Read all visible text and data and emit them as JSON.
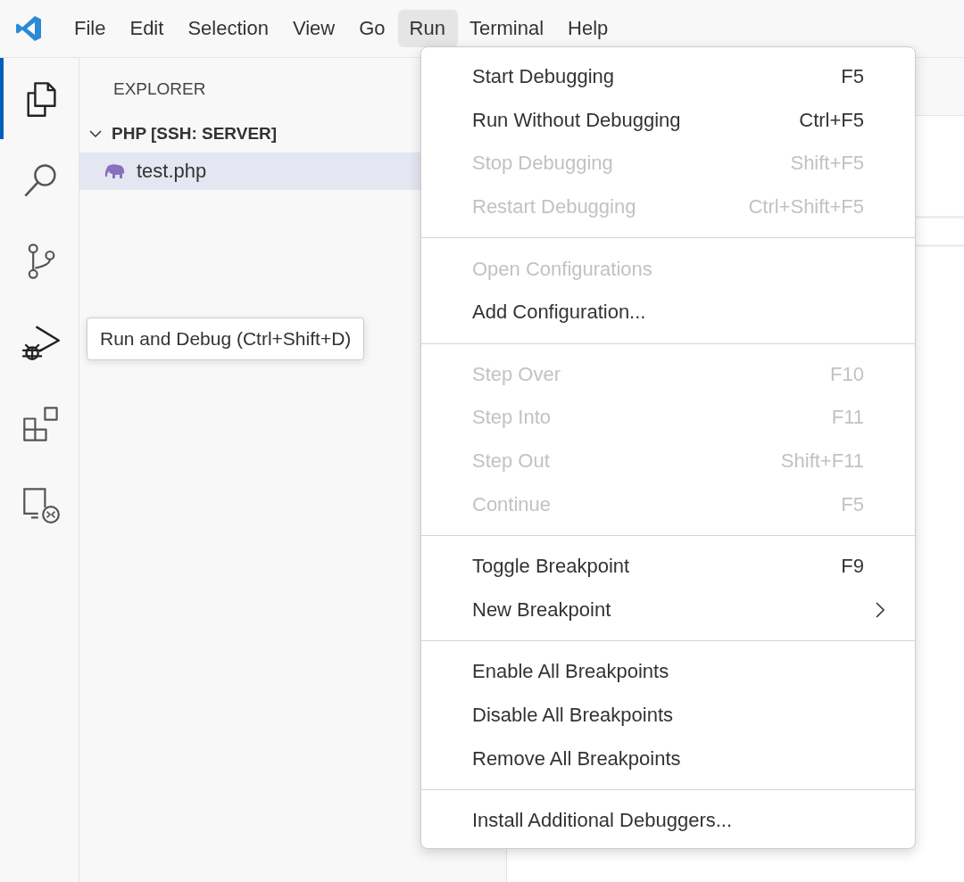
{
  "menubar": [
    {
      "label": "File",
      "selected": false
    },
    {
      "label": "Edit",
      "selected": false
    },
    {
      "label": "Selection",
      "selected": false
    },
    {
      "label": "View",
      "selected": false
    },
    {
      "label": "Go",
      "selected": false
    },
    {
      "label": "Run",
      "selected": true
    },
    {
      "label": "Terminal",
      "selected": false
    },
    {
      "label": "Help",
      "selected": false
    }
  ],
  "activity_bar": [
    {
      "kind": "explorer",
      "selected": true
    },
    {
      "kind": "search",
      "selected": false
    },
    {
      "kind": "source-control",
      "selected": false
    },
    {
      "kind": "run-debug",
      "selected": false
    },
    {
      "kind": "extensions",
      "selected": false
    },
    {
      "kind": "remote",
      "selected": false
    }
  ],
  "tooltip": "Run and Debug (Ctrl+Shift+D)",
  "explorer": {
    "title": "EXPLORER",
    "folder": {
      "label": "PHP [SSH: SERVER]",
      "expanded": true
    },
    "files": [
      {
        "name": "test.php",
        "selected": true
      }
    ]
  },
  "run_menu": [
    [
      {
        "label": "Start Debugging",
        "shortcut": "F5",
        "disabled": false,
        "submenu": false
      },
      {
        "label": "Run Without Debugging",
        "shortcut": "Ctrl+F5",
        "disabled": false,
        "submenu": false
      },
      {
        "label": "Stop Debugging",
        "shortcut": "Shift+F5",
        "disabled": true,
        "submenu": false
      },
      {
        "label": "Restart Debugging",
        "shortcut": "Ctrl+Shift+F5",
        "disabled": true,
        "submenu": false
      }
    ],
    [
      {
        "label": "Open Configurations",
        "disabled": true,
        "submenu": false
      },
      {
        "label": "Add Configuration...",
        "disabled": false,
        "submenu": false
      }
    ],
    [
      {
        "label": "Step Over",
        "shortcut": "F10",
        "disabled": true,
        "submenu": false
      },
      {
        "label": "Step Into",
        "shortcut": "F11",
        "disabled": true,
        "submenu": false
      },
      {
        "label": "Step Out",
        "shortcut": "Shift+F11",
        "disabled": true,
        "submenu": false
      },
      {
        "label": "Continue",
        "shortcut": "F5",
        "disabled": true,
        "submenu": false
      }
    ],
    [
      {
        "label": "Toggle Breakpoint",
        "shortcut": "F9",
        "disabled": false,
        "submenu": false
      },
      {
        "label": "New Breakpoint",
        "disabled": false,
        "submenu": true
      }
    ],
    [
      {
        "label": "Enable All Breakpoints",
        "disabled": false,
        "submenu": false
      },
      {
        "label": "Disable All Breakpoints",
        "disabled": false,
        "submenu": false
      },
      {
        "label": "Remove All Breakpoints",
        "disabled": false,
        "submenu": false
      }
    ],
    [
      {
        "label": "Install Additional Debuggers...",
        "disabled": false,
        "submenu": false
      }
    ]
  ]
}
